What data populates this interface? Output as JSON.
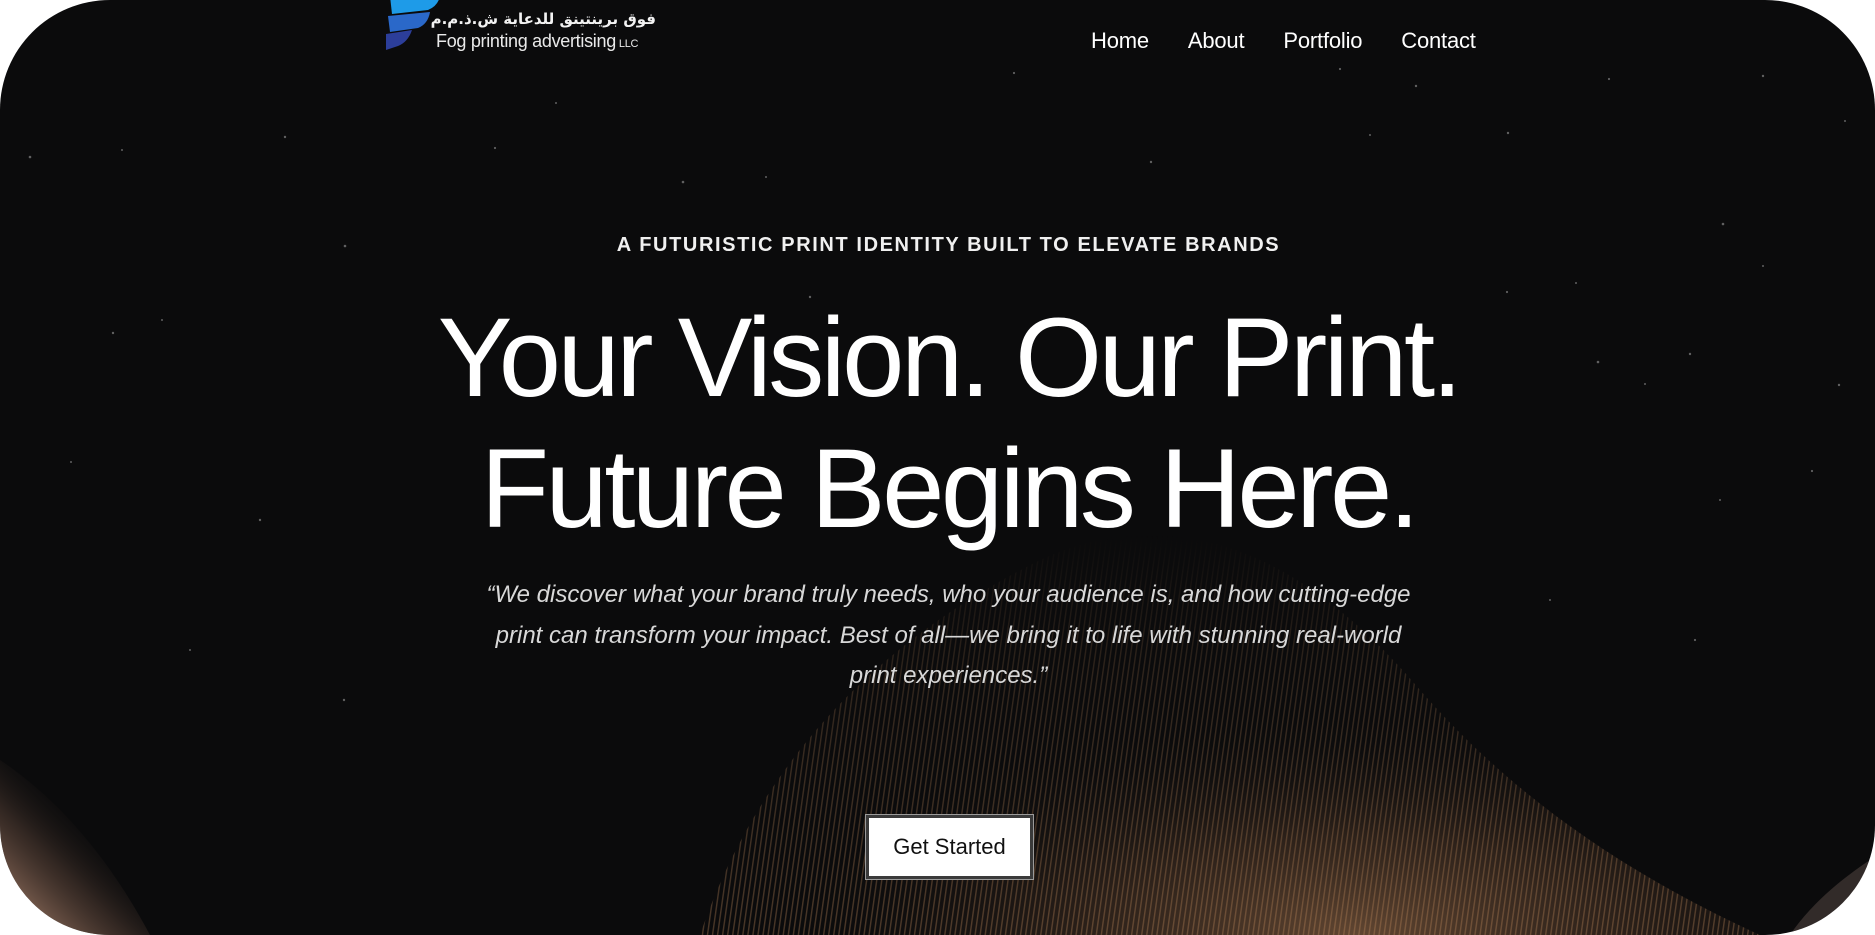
{
  "brand": {
    "logo_ar": "فوق برينتينق للدعاية ش.ذ.م.م",
    "logo_en": "Fog printing advertising",
    "logo_en_suffix": "LLC"
  },
  "nav": {
    "items": [
      "Home",
      "About",
      "Portfolio",
      "Contact"
    ]
  },
  "hero": {
    "eyebrow": "A FUTURISTIC PRINT IDENTITY BUILT TO ELEVATE BRANDS",
    "headline_line1": "Your Vision. Our Print.",
    "headline_line2": "Future Begins Here.",
    "quote": "“We discover what your brand truly needs, who your audience is, and how cutting-edge print can transform your impact. Best of all—we bring it to life with stunning real-world print experiences.”",
    "cta_label": "Get Started"
  },
  "colors": {
    "background": "#0b0b0c",
    "logo_blue_top": "#1e9be8",
    "logo_blue_mid": "#2a68c9",
    "logo_blue_bottom": "#2c3e9a",
    "glow": "#c88a5a",
    "text": "#ffffff"
  },
  "icons": {
    "logo_mark": "fog-logo-mark-icon"
  }
}
